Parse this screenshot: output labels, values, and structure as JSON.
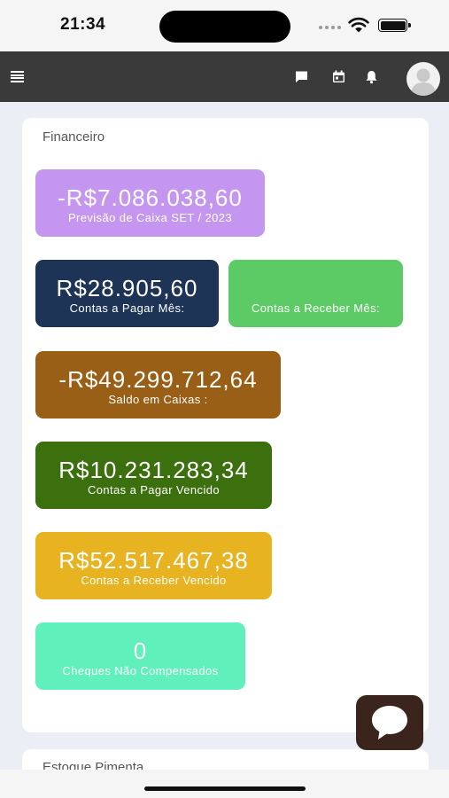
{
  "status_bar": {
    "time": "21:34"
  },
  "topbar": {
    "menu_icon": "hamburger-icon",
    "icons": [
      "chat-icon",
      "calendar-icon",
      "bell-icon"
    ],
    "avatar_icon": "user-avatar-icon",
    "background": "#3a3a3a"
  },
  "financeiro": {
    "title": "Financeiro",
    "tiles": [
      {
        "value": "-R$7.086.038,60",
        "label": "Previsão de Caixa SET / 2023",
        "color": "#c496f0"
      },
      {
        "value": "R$28.905,60",
        "label": "Contas a Pagar Mês:",
        "color": "#1e3456"
      },
      {
        "value": "",
        "label": "Contas a Receber Mês:",
        "color": "#5dcb65"
      },
      {
        "value": "-R$49.299.712,64",
        "label": "Saldo em Caixas :",
        "color": "#9a5f16"
      },
      {
        "value": "R$10.231.283,34",
        "label": "Contas a Pagar Vencido",
        "color": "#3c6f0e"
      },
      {
        "value": "R$52.517.467,38",
        "label": "Contas a Receber Vencido",
        "color": "#e7b321"
      },
      {
        "value": "0",
        "label": "Cheques Não Compensados",
        "color": "#5ff0bb"
      }
    ]
  },
  "estoque": {
    "title": "Estoque Pimenta"
  },
  "chat_fab": {
    "icon": "chat-bubble-icon",
    "color": "#3b241b"
  }
}
